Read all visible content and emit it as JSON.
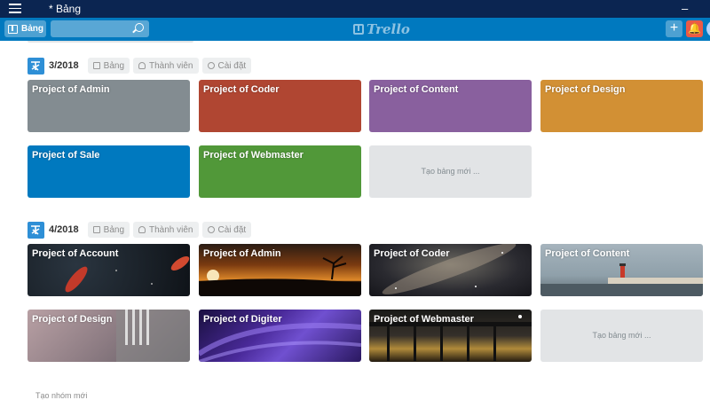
{
  "window": {
    "title": "* Bảng",
    "minimize": "–"
  },
  "appbar": {
    "boards_label": "Bảng",
    "search_value": "",
    "logo_text": "Trello",
    "add_label": "+",
    "notif_label": "🔔"
  },
  "groups": [
    {
      "title": "3/2018",
      "buttons": {
        "boards": "Bảng",
        "members": "Thành viên",
        "settings": "Cài đặt"
      },
      "boards": [
        {
          "name": "Project of Admin",
          "color": "#838c91"
        },
        {
          "name": "Project of Coder",
          "color": "#b04632"
        },
        {
          "name": "Project of Content",
          "color": "#89609e"
        },
        {
          "name": "Project of Design",
          "color": "#d29034"
        },
        {
          "name": "Project of Sale",
          "color": "#0079bf"
        },
        {
          "name": "Project of Webmaster",
          "color": "#519839"
        }
      ],
      "new_board": "Tạo bảng mới ..."
    },
    {
      "title": "4/2018",
      "buttons": {
        "boards": "Bảng",
        "members": "Thành viên",
        "settings": "Cài đặt"
      },
      "boards": [
        {
          "name": "Project of Account",
          "image": "koi-fish-dark"
        },
        {
          "name": "Project of Admin",
          "image": "sunset-tree"
        },
        {
          "name": "Project of Coder",
          "image": "milky-way"
        },
        {
          "name": "Project of Content",
          "image": "lighthouse-pier"
        },
        {
          "name": "Project of Design",
          "image": "columns-building"
        },
        {
          "name": "Project of Digiter",
          "image": "purple-abstract"
        },
        {
          "name": "Project of Webmaster",
          "image": "pier-at-night"
        }
      ],
      "new_board": "Tạo bảng mới ..."
    }
  ],
  "new_group": "Tạo nhóm mới"
}
